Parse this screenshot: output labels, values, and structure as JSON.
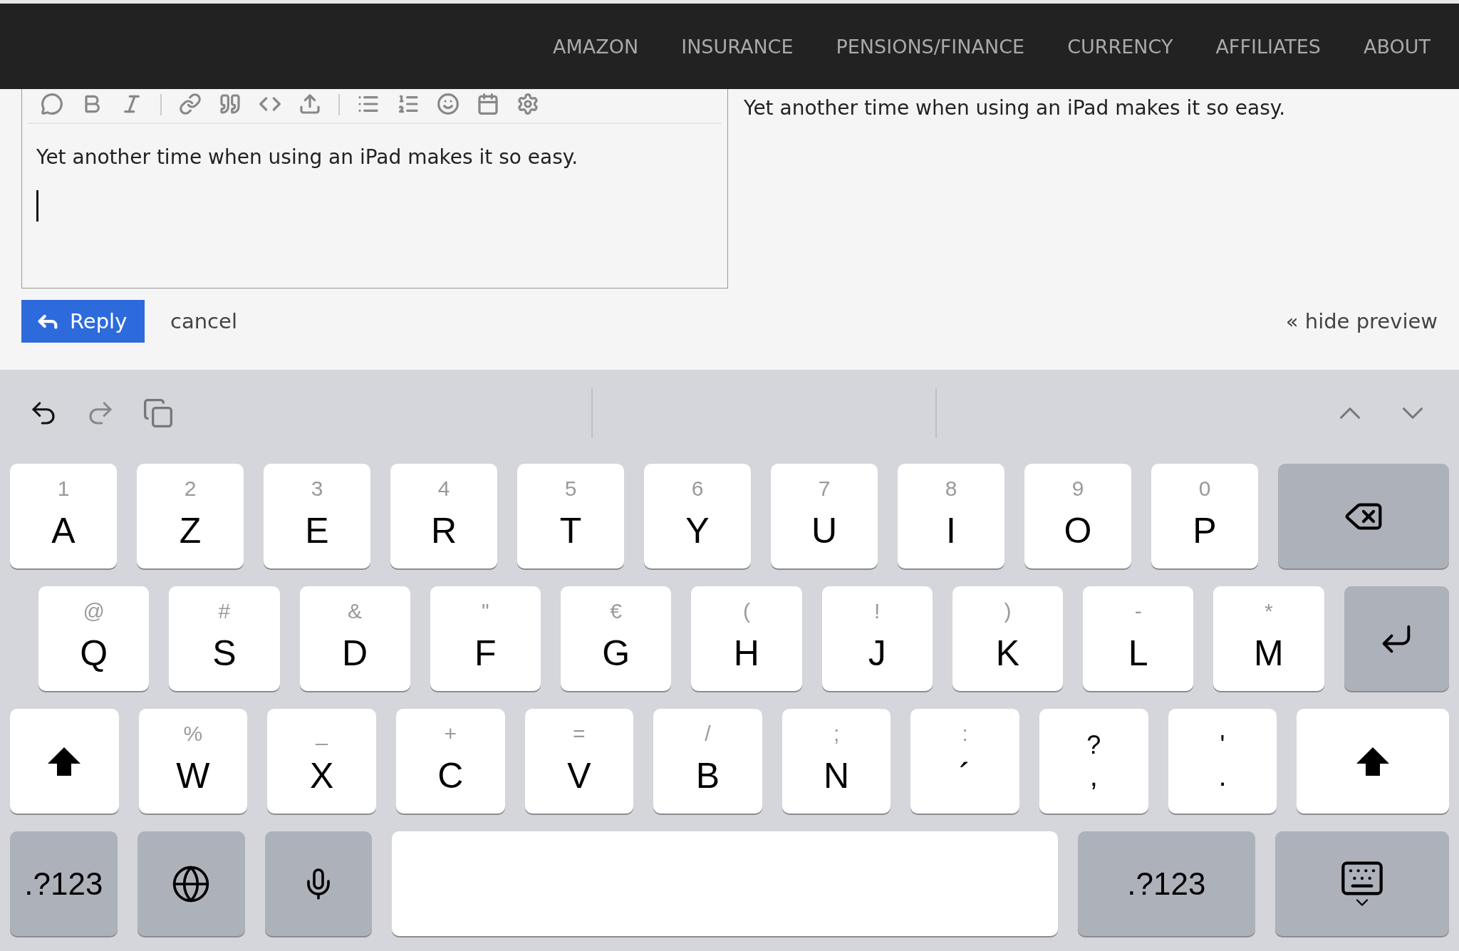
{
  "nav": {
    "items": [
      "AMAZON",
      "INSURANCE",
      "PENSIONS/FINANCE",
      "CURRENCY",
      "AFFILIATES",
      "ABOUT"
    ]
  },
  "editor": {
    "toolbar": [
      {
        "kind": "comment"
      },
      {
        "kind": "bold"
      },
      {
        "kind": "italic"
      },
      {
        "kind": "sep"
      },
      {
        "kind": "link"
      },
      {
        "kind": "quote"
      },
      {
        "kind": "code"
      },
      {
        "kind": "upload"
      },
      {
        "kind": "sep"
      },
      {
        "kind": "bullets"
      },
      {
        "kind": "numbers"
      },
      {
        "kind": "emoji"
      },
      {
        "kind": "calendar"
      },
      {
        "kind": "settings"
      }
    ],
    "value": "Yet another time when using an iPad makes it so easy."
  },
  "preview": {
    "text": "Yet another time when using an iPad makes it so easy."
  },
  "actions": {
    "reply": "Reply",
    "cancel": "cancel",
    "hide_preview": "« hide preview"
  },
  "keyboard": {
    "rows": [
      [
        {
          "kind": "letter",
          "alt": "1",
          "main": "A"
        },
        {
          "kind": "letter",
          "alt": "2",
          "main": "Z"
        },
        {
          "kind": "letter",
          "alt": "3",
          "main": "E"
        },
        {
          "kind": "letter",
          "alt": "4",
          "main": "R"
        },
        {
          "kind": "letter",
          "alt": "5",
          "main": "T"
        },
        {
          "kind": "letter",
          "alt": "6",
          "main": "Y"
        },
        {
          "kind": "letter",
          "alt": "7",
          "main": "U"
        },
        {
          "kind": "letter",
          "alt": "8",
          "main": "I"
        },
        {
          "kind": "letter",
          "alt": "9",
          "main": "O"
        },
        {
          "kind": "letter",
          "alt": "0",
          "main": "P"
        },
        {
          "kind": "backspace"
        }
      ],
      [
        {
          "kind": "letter",
          "alt": "@",
          "main": "Q"
        },
        {
          "kind": "letter",
          "alt": "#",
          "main": "S"
        },
        {
          "kind": "letter",
          "alt": "&",
          "main": "D"
        },
        {
          "kind": "letter",
          "alt": "\"",
          "main": "F"
        },
        {
          "kind": "letter",
          "alt": "€",
          "main": "G"
        },
        {
          "kind": "letter",
          "alt": "(",
          "main": "H"
        },
        {
          "kind": "letter",
          "alt": "!",
          "main": "J"
        },
        {
          "kind": "letter",
          "alt": ")",
          "main": "K"
        },
        {
          "kind": "letter",
          "alt": "-",
          "main": "L"
        },
        {
          "kind": "letter",
          "alt": "*",
          "main": "M"
        },
        {
          "kind": "return"
        }
      ],
      [
        {
          "kind": "shift"
        },
        {
          "kind": "letter",
          "alt": "%",
          "main": "W"
        },
        {
          "kind": "letter",
          "alt": "_",
          "main": "X"
        },
        {
          "kind": "letter",
          "alt": "+",
          "main": "C"
        },
        {
          "kind": "letter",
          "alt": "=",
          "main": "V"
        },
        {
          "kind": "letter",
          "alt": "/",
          "main": "B"
        },
        {
          "kind": "letter",
          "alt": ";",
          "main": "N"
        },
        {
          "kind": "letter",
          "alt": ":",
          "main": "´"
        },
        {
          "kind": "dual",
          "top": "?",
          "main": ","
        },
        {
          "kind": "dual",
          "top": "'",
          "main": "."
        },
        {
          "kind": "shift"
        }
      ],
      [
        {
          "kind": "mode",
          "label": ".?123"
        },
        {
          "kind": "globe"
        },
        {
          "kind": "mic"
        },
        {
          "kind": "space"
        },
        {
          "kind": "mode",
          "label": ".?123"
        },
        {
          "kind": "hide"
        }
      ]
    ]
  }
}
